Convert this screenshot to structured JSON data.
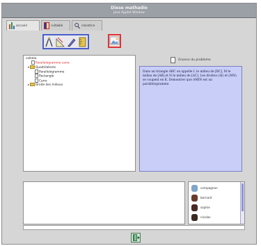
{
  "window": {
    "title": "Diese mathadio",
    "subtitle": "Java Applet Window"
  },
  "tabs": [
    {
      "label": "accueil",
      "icon": "bar-chart-icon"
    },
    {
      "label": "ruitable",
      "icon": "book-icon"
    },
    {
      "label": "classtice",
      "icon": "magnifier-icon"
    }
  ],
  "toolbar": {
    "tools": [
      "compass-icon",
      "geometry-tool-icon",
      "pen-icon",
      "ruler-icon"
    ],
    "image_button_icon": "picture-icon"
  },
  "tree": {
    "root": "collatia",
    "nodes": [
      {
        "label": "Parallelogramme carre",
        "level": 1,
        "type": "doc",
        "highlight": true
      },
      {
        "label": "Quadrilateres",
        "level": 1,
        "type": "folder",
        "expanded": true
      },
      {
        "label": "Parallelogramme",
        "level": 2,
        "type": "doc"
      },
      {
        "label": "Rectangle",
        "level": 2,
        "type": "doc"
      },
      {
        "label": "Carre",
        "level": 2,
        "type": "doc"
      },
      {
        "label": "Droite des milieux",
        "level": 1,
        "type": "folder",
        "expanded": false
      }
    ]
  },
  "statement": {
    "header": "Enonce du probleme",
    "text": "Dans un triangle ABC on appelle I, le milieu de [BC], M le milieu de [AB] et N le milieu de [AC]. Les droites (AI) et (MN) se coupent en K. Demontrer que AMIN est un parallelogramme."
  },
  "users": [
    {
      "name": "compagnon",
      "color": "#7fa6c9"
    },
    {
      "name": "bernard",
      "color": "#6b3b2a"
    },
    {
      "name": "sophie",
      "color": "#4a2a24"
    },
    {
      "name": "nicolas",
      "color": "#3a2a20"
    }
  ],
  "colors": {
    "accent": "#4a5ec9",
    "statement_bg": "#c9cef8",
    "highlight_red": "#e02a2a"
  },
  "footer": {
    "exit_icon": "exit-door-icon"
  }
}
